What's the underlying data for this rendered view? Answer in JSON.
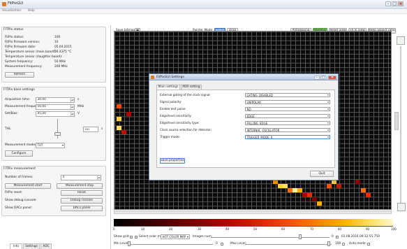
{
  "window": {
    "title": "FitPixGUI",
    "minimize": "–",
    "maximize": "□",
    "close": "✕"
  },
  "menu": {
    "items": [
      "Visualization",
      "Help"
    ]
  },
  "fitpix_status": {
    "title": "FITPix status",
    "rows": [
      {
        "label": "FitPix status:",
        "value": "100"
      },
      {
        "label": "FitPix firmware version:",
        "value": "10"
      },
      {
        "label": "FitPix firmware date:",
        "value": "05.04.2015"
      },
      {
        "label": "Temperature sensor (main board):",
        "value": "56.4375 °C"
      },
      {
        "label": "Temperature sensor (daughter board):",
        "value": "-"
      },
      {
        "label": "System frequency:",
        "value": "50 MHz"
      },
      {
        "label": "Measurement frequency:",
        "value": "200 MHz"
      }
    ],
    "refresh_label": "Refresh"
  },
  "base_settings": {
    "title": "FITPix base settings",
    "acq_time_label": "Acquisition time:",
    "acq_time_value": "30,00",
    "acq_time_unit": "s",
    "meas_freq_label": "Measurement frequency:",
    "meas_freq_value": "50,00",
    "meas_freq_unit": "MHz",
    "settings_label": "Set/Bias:",
    "settings_value": "45,00",
    "settings_unit": "V",
    "thl_label": "THL:",
    "thl_value": "291",
    "thl_unit": "s",
    "mode_label": "Measurement modes:",
    "mode_value": "TOT",
    "configure_label": "Configure"
  },
  "measurement": {
    "title": "FITPix measurement",
    "frames_label": "Number of frames:",
    "frames_value": "4",
    "start_label": "Measurement start",
    "stop_label": "Measurement stop",
    "reset_row_label": "FitPix reset:",
    "reset_btn": "Reset",
    "debug_row_label": "Show debug console:",
    "debug_btn": "Debug console",
    "dacs_row_label": "Show DACs panel:",
    "dacs_btn": "DACs panel"
  },
  "left_tabs": [
    "Info",
    "Settings",
    "ADC"
  ],
  "toolbar": {
    "save_bitmap": "Save bitmap",
    "pointer_mode_label": "Pointer Mode",
    "select": "Select",
    "drag": "Drag",
    "antialiasing": "Antialiasing",
    "opengl": "OpenGL",
    "reset_view": "Reset view",
    "fit_in_view": "Fit in view",
    "keep_aspect": "Keep aspect ratio"
  },
  "dialog": {
    "title": "FitPixGUI Settings",
    "tabs": [
      "Main settings",
      "PDR setting"
    ],
    "rows": [
      {
        "label": "External gating of the clock signal:",
        "value": "GATING_DISABLED"
      },
      {
        "label": "Signal polarity:",
        "value": "UNIPOLAR"
      },
      {
        "label": "Enable test pulse:",
        "value": "NO"
      },
      {
        "label": "Edge/level sensitivity:",
        "value": "EDGE"
      },
      {
        "label": "Edge/level sensitivity type:",
        "value": "FALLING_EDGE"
      },
      {
        "label": "Clock source selection for detector:",
        "value": "INTERNAL_OSCILLATOR"
      },
      {
        "label": "Trigger mode:",
        "value": "TRIGGER_MODE_0"
      }
    ],
    "save_label": "Save properties",
    "quit_label": "Quit"
  },
  "colorbar_ticks": [
    "0",
    "10",
    "20",
    "30",
    "40",
    "50",
    "60",
    "70",
    "80",
    "90",
    "100"
  ],
  "status": {
    "show_grid": "Show grid:",
    "select_color_map": "Select color map:",
    "color_map_value": "HOT COLOR MAP",
    "images_num": "Images num:",
    "images_value": "0",
    "datetime": "01.08.2016 09:32:55.759",
    "min_level": "Min Level:",
    "min_value": "0",
    "max_level": "Max Level:",
    "max_value": "100",
    "auto_mode": "Auto mode:"
  },
  "colors": {
    "accent_green": "#7ec86a",
    "select_blue": "#5b8ed8",
    "dialog_border": "#7d92b5"
  }
}
